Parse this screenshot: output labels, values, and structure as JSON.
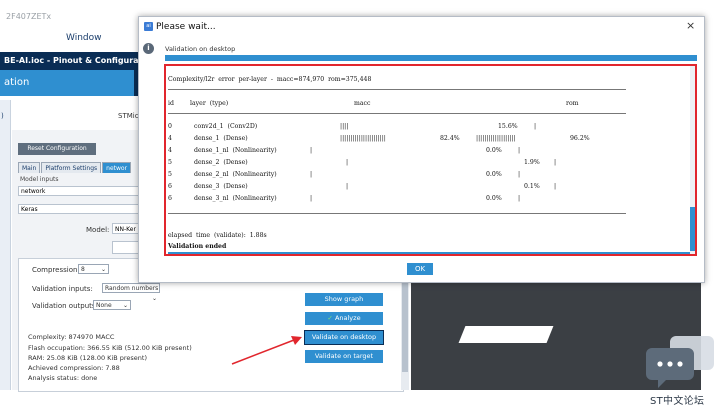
{
  "app": {
    "title": "2F407ZETx",
    "menu_window": "Window",
    "header_bar": "BE-AI.ioc - Pinout & Configuration",
    "section_label": "ation",
    "left_strip_text": ")",
    "stm_label": "STMic"
  },
  "config_panel": {
    "reset_button": "Reset Configuration",
    "tabs": [
      "Main",
      "Platform Settings",
      "networ"
    ],
    "model_inputs_label": "Model inputs",
    "network_field": "network",
    "keras_field": "Keras",
    "model_label": "Model:",
    "model_field": "NN-Ker"
  },
  "settings": {
    "compression_label": "Compression:",
    "compression_value": "8",
    "validation_inputs_label": "Validation inputs:",
    "validation_inputs_value": "Random numbers",
    "validation_outputs_label": "Validation outputs:",
    "validation_outputs_value": "None",
    "complexity": "Complexity:  874970 MACC",
    "flash": "Flash occupation: 366.55 KiB (512.00 KiB present)",
    "ram": "RAM: 25.08 KiB (128.00 KiB present)",
    "achieved_compression": "Achieved compression: 7.88",
    "analysis_status": "Analysis status: done"
  },
  "buttons": {
    "show_graph": "Show graph",
    "analyze": "Analyze",
    "analyze_check": "✓",
    "validate_desktop": "Validate on desktop",
    "validate_target": "Validate on target"
  },
  "dialog": {
    "title": "Please wait...",
    "close": "×",
    "info_icon": "i",
    "subtitle": "Validation on desktop",
    "ok_button": "OK",
    "console": {
      "header": "Complexity/l2r  error  per-layer  -  macc=874,970  rom=375,448",
      "columns": {
        "id": "id",
        "layer": "layer  (type)",
        "macc": "macc",
        "rom": "rom"
      },
      "rows": [
        {
          "id": "0",
          "layer": "conv2d_1  (Conv2D)",
          "macc_bar": "||||",
          "macc_pct": "15.6%",
          "rom_bar": "|",
          "rom_pct": ""
        },
        {
          "id": "4",
          "layer": "dense_1  (Dense)",
          "macc_bar": "||||||||||||||||||||||",
          "macc_pct": "82.4%",
          "rom_bar": "|||||||||||||||||||",
          "rom_pct": "96.2%"
        },
        {
          "id": "4",
          "layer": "dense_1_nl  (Nonlinearity)",
          "macc_bar": "|",
          "macc_pct": "0.0%",
          "rom_bar": "|",
          "rom_pct": ""
        },
        {
          "id": "5",
          "layer": "dense_2  (Dense)",
          "macc_bar": "|",
          "macc_pct": "1.9%",
          "rom_bar": "|",
          "rom_pct": ""
        },
        {
          "id": "5",
          "layer": "dense_2_nl  (Nonlinearity)",
          "macc_bar": "|",
          "macc_pct": "0.0%",
          "rom_bar": "|",
          "rom_pct": ""
        },
        {
          "id": "6",
          "layer": "dense_3  (Dense)",
          "macc_bar": "|",
          "macc_pct": "0.1%",
          "rom_bar": "|",
          "rom_pct": ""
        },
        {
          "id": "6",
          "layer": "dense_3_nl  (Nonlinearity)",
          "macc_bar": "|",
          "macc_pct": "0.0%",
          "rom_bar": "|",
          "rom_pct": ""
        }
      ],
      "elapsed": "elapsed  time  (validate):  1.88s",
      "ended": "Validation ended"
    }
  },
  "watermark": {
    "text": "ST中文论坛"
  },
  "colors": {
    "accent": "#2f8fd0",
    "dark_navy": "#0a2d55",
    "highlight": "#e1262d",
    "analyze_check": "#7be07b"
  }
}
